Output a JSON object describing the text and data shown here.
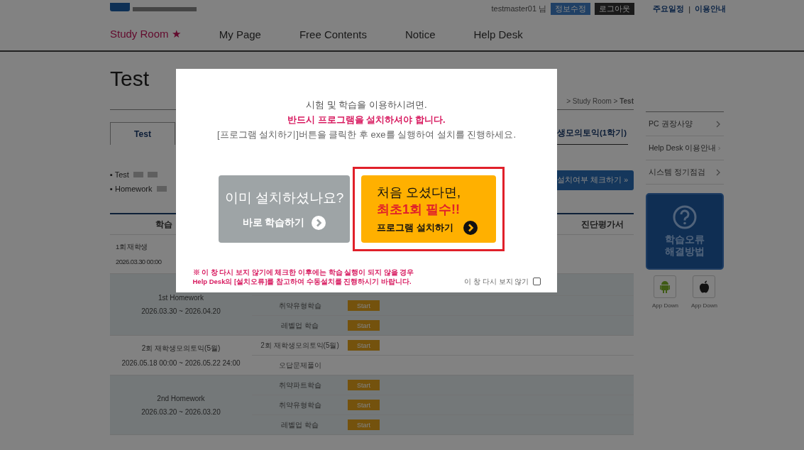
{
  "header": {
    "user": "testmaster01 님",
    "buttons": [
      {
        "label": "정보수정",
        "kind": "blue"
      },
      {
        "label": "로그아웃",
        "kind": "dark"
      }
    ],
    "links": [
      "주요일정",
      "이용안내"
    ],
    "separator": "|"
  },
  "nav": [
    {
      "label": "Study Room ★",
      "selected": true
    },
    {
      "label": "My Page",
      "selected": false
    },
    {
      "label": "Free Contents",
      "selected": false
    },
    {
      "label": "Notice",
      "selected": false
    },
    {
      "label": "Help Desk",
      "selected": false
    }
  ],
  "page": {
    "title": "Test",
    "breadcrumb": "> Study Room > **Test**"
  },
  "tabs": [
    {
      "label": "Test",
      "selected": true
    },
    {
      "label": "생모의토익(1학기)",
      "selected": false
    }
  ],
  "legend": [
    {
      "label": "▪ Test"
    },
    {
      "label": "▪ Homework"
    }
  ],
  "check_button": "설치여부 체크하기 »",
  "table": {
    "columns": [
      "학습",
      "진단평가서"
    ],
    "groups": [
      {
        "title": "1회 재학생",
        "period": "2026.03.30 00:00",
        "shaded": false
      },
      {
        "title": "1st Homework",
        "period": "2026.03.30 ~ 2026.04.20",
        "shaded": true,
        "items": [
          {
            "name": "취약유형학습",
            "action": "Start"
          },
          {
            "name": "레벨업 학습",
            "action": "Start"
          }
        ]
      },
      {
        "title": "2회 재학생모의토익(5월)",
        "period": "2026.05.18 00:00 ~ 2026.05.22 24:00",
        "shaded": false,
        "items": [
          {
            "name": "2회 재학생모의토익(5월)",
            "action": "Start"
          },
          {
            "name": "오답문제풀이"
          }
        ]
      },
      {
        "title": "2nd Homework",
        "period": "2026.03.20 ~ 2026.03.20",
        "shaded": true,
        "items": [
          {
            "name": "취약파트학습",
            "action": "Start"
          },
          {
            "name": "취약유형학습",
            "action": "Start"
          },
          {
            "name": "레벨업 학습",
            "action": "Start"
          }
        ]
      }
    ]
  },
  "sidebar": {
    "links": [
      "PC 권장사양",
      "Help Desk 이용안내",
      "시스템 정기점검"
    ],
    "help_box": "학습오류 해결방법",
    "apps": [
      {
        "kind": "android",
        "label": "App Down"
      },
      {
        "kind": "apple",
        "label": "App Down"
      }
    ]
  },
  "modal": {
    "intro": "시험 및 학습을 이용하시려면.",
    "emphasis": "반드시 프로그램을 설치하셔야 합니다.",
    "instruction": "[프로그램 설치하기]버튼을 클릭한 후 exe를 실행하여 설치를 진행하세요.",
    "installed_button": {
      "question": "이미 설치하셨나요?",
      "action": "바로 학습하기"
    },
    "install_button": {
      "line1": "처음 오셨다면,",
      "line2": "최초1회 필수!!",
      "action": "프로그램 설치하기",
      "highlighted": true
    },
    "notice_lines": [
      "※ 이 창 다시 보지 않기에 체크한 이후에는 학습 실행이 되지 않을 경우",
      "Help Desk의 [설치오류]를 참고하여 수동설치를 진행하시기 바랍니다."
    ],
    "dont_show": {
      "label": "이 창 다시 보지 않기",
      "checked": false
    }
  }
}
